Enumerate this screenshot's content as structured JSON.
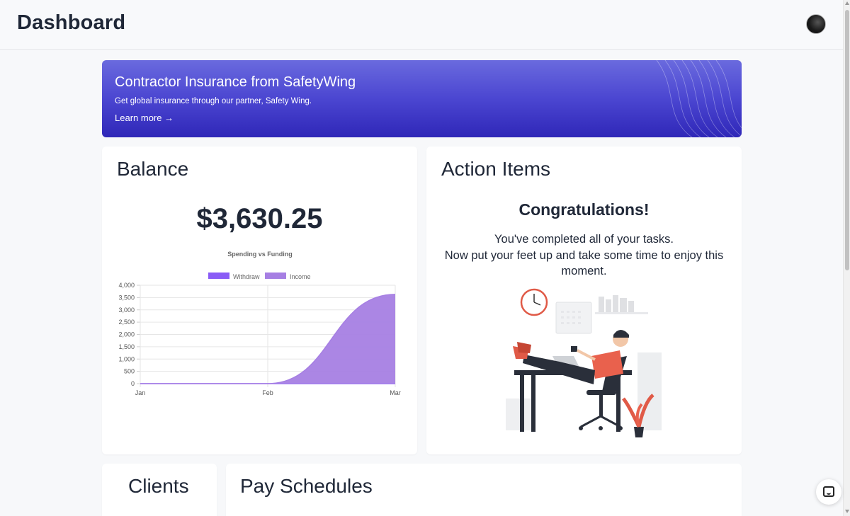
{
  "header": {
    "title": "Dashboard"
  },
  "banner": {
    "title": "Contractor Insurance from SafetyWing",
    "subtitle": "Get global insurance through our partner, Safety Wing.",
    "link_label": "Learn more →",
    "colors": {
      "top": "#6a6ade",
      "bottom": "#2f27b8"
    }
  },
  "balance": {
    "heading": "Balance",
    "amount": "$3,630.25"
  },
  "chart_data": {
    "type": "area",
    "title": "Spending vs Funding",
    "categories": [
      "Jan",
      "Feb",
      "Mar"
    ],
    "y_ticks": [
      "4,000",
      "3,500",
      "3,000",
      "2,500",
      "2,000",
      "1,500",
      "1,000",
      "500",
      "0"
    ],
    "ylim": [
      0,
      4000
    ],
    "grid": true,
    "legend_position": "top",
    "series": [
      {
        "name": "Withdraw",
        "values": [
          0,
          0,
          0
        ],
        "color": "#8a5cf6"
      },
      {
        "name": "Income",
        "values": [
          0,
          0,
          3630
        ],
        "color": "#a67fe3"
      }
    ]
  },
  "action_items": {
    "heading": "Action Items",
    "congrats": "Congratulations!",
    "message_line1": "You've completed all of your tasks.",
    "message_line2": "Now put your feet up and take some time to enjoy this moment."
  },
  "sections": {
    "clients": "Clients",
    "pay_schedules": "Pay Schedules"
  },
  "icons": {
    "avatar": "avatar",
    "chat": "chat-icon"
  }
}
